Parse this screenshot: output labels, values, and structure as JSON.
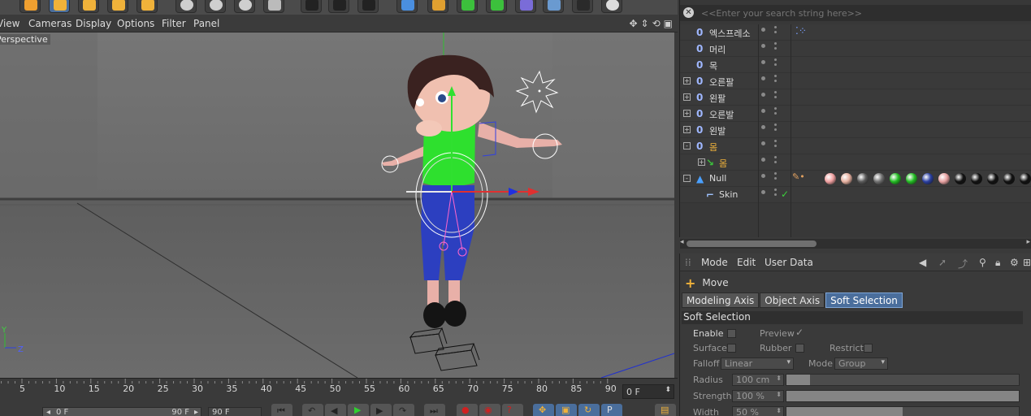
{
  "viewport_menu": {
    "items": [
      "View",
      "Cameras",
      "Display",
      "Options",
      "Filter",
      "Panel"
    ],
    "view_label": "Perspective"
  },
  "axes": {
    "y": "Y",
    "z": "Z"
  },
  "timeline": {
    "ticks": [
      "5",
      "10",
      "15",
      "20",
      "25",
      "30",
      "35",
      "40",
      "45",
      "50",
      "55",
      "60",
      "65",
      "70",
      "75",
      "80",
      "85",
      "90"
    ],
    "current_frame": "0 F",
    "range_start": "0 F",
    "range_end": "90 F",
    "end_frame": "90 F"
  },
  "object_manager": {
    "search_placeholder": "<<Enter your search string here>>",
    "rows": [
      {
        "name": "엑스프레소",
        "indent": 1,
        "expand": ""
      },
      {
        "name": "머리",
        "indent": 1,
        "expand": ""
      },
      {
        "name": "목",
        "indent": 1,
        "expand": ""
      },
      {
        "name": "오른팔",
        "indent": 1,
        "expand": "+"
      },
      {
        "name": "왼팔",
        "indent": 1,
        "expand": "+"
      },
      {
        "name": "오른발",
        "indent": 1,
        "expand": "+"
      },
      {
        "name": "왼발",
        "indent": 1,
        "expand": "+"
      },
      {
        "name": "몸",
        "indent": 1,
        "expand": "-"
      },
      {
        "name": "몸",
        "indent": 2,
        "expand": "+"
      },
      {
        "name": "Null",
        "indent": 1,
        "expand": "-"
      },
      {
        "name": "Skin",
        "indent": 2,
        "expand": ""
      }
    ],
    "material_colors": [
      "#f0a0a0",
      "#e6b0a0",
      "#5a5a5a",
      "#707070",
      "#22bb22",
      "#22bb22",
      "#2a3fa0",
      "#e6a0a0",
      "#111111",
      "#111111",
      "#111111",
      "#111111",
      "#111111"
    ]
  },
  "attribute_manager": {
    "menu": [
      "Mode",
      "Edit",
      "User Data"
    ],
    "tool_name": "Move",
    "tabs": [
      {
        "label": "Modeling Axis",
        "active": false
      },
      {
        "label": "Object Axis",
        "active": false
      },
      {
        "label": "Soft Selection",
        "active": true
      }
    ],
    "section_title": "Soft Selection",
    "enable_label": "Enable",
    "preview_label": "Preview",
    "surface_label": "Surface",
    "rubber_label": "Rubber",
    "restrict_label": "Restrict",
    "falloff_label": "Falloff",
    "falloff_value": "Linear",
    "mode_label": "Mode",
    "mode_value": "Group",
    "radius_label": "Radius",
    "radius_value": "100 cm",
    "strength_label": "Strength",
    "strength_value": "100 %",
    "width_label": "Width",
    "width_value": "50 %",
    "radius_fraction": 0.1,
    "strength_fraction": 1.0,
    "width_fraction": 0.5
  }
}
